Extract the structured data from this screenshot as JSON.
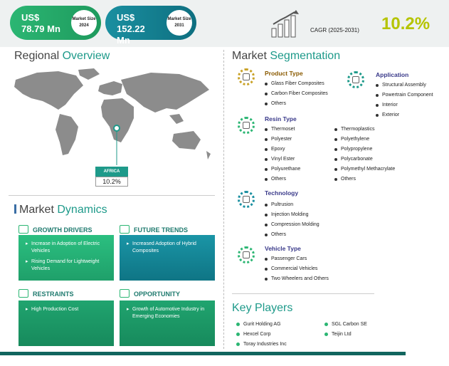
{
  "header": {
    "market_2024": {
      "value": "US$  78.79 Mn",
      "badge": "Market Size 2024"
    },
    "market_2031": {
      "value": "US$  152.22 Mn",
      "badge": "Market Size 2031"
    },
    "cagr_label": "CAGR (2025-2031)",
    "cagr_value": "10.2%",
    "colors": {
      "green": "#2bb673",
      "teal": "#0e6f80",
      "accent": "#b5c400"
    }
  },
  "regional": {
    "title_a": "Regional",
    "title_b": "Overview",
    "region_label": "AFRICA",
    "region_value": "10.2%"
  },
  "dynamics": {
    "title_a": "Market",
    "title_b": "Dynamics",
    "growth_drivers": {
      "label": "GROWTH DRIVERS",
      "items": [
        "Increase in Adoption of Electric Vehicles",
        "Rising Demand for Lightweight Vehicles"
      ]
    },
    "future_trends": {
      "label": "FUTURE TRENDS",
      "items": [
        "Increased Adoption of Hybrid Composites"
      ]
    },
    "restraints": {
      "label": "RESTRAINTS",
      "items": [
        "High Production Cost"
      ]
    },
    "opportunity": {
      "label": "OPPORTUNITY",
      "items": [
        "Growth of Automotive Industry in Emerging Economies"
      ]
    }
  },
  "segmentation": {
    "title_a": "Market",
    "title_b": "Segmentation",
    "product_type": {
      "label": "Product Type",
      "items": [
        "Glass Fiber Composites",
        "Carbon Fiber Composites",
        "Others"
      ]
    },
    "application": {
      "label": "Application",
      "items": [
        "Structural Assembly",
        "Powertrain Component",
        "Interior",
        "Exterior"
      ]
    },
    "resin_type": {
      "label": "Resin Type",
      "col1": [
        "Thermoset",
        "Polyester",
        "Epoxy",
        "Vinyl Ester",
        "Polyurethane",
        "Others"
      ],
      "col2": [
        "Thermoplastics",
        "Polyethylene",
        "Polypropylene",
        "Polycarbonate",
        "Polymethyl Methacrylate",
        "Others"
      ]
    },
    "technology": {
      "label": "Technology",
      "items": [
        "Pultrusion",
        "Injection Molding",
        "Compression Molding",
        "Others"
      ]
    },
    "vehicle_type": {
      "label": "Vehicle Type",
      "items": [
        "Passenger Cars",
        "Commercial Vehicles",
        "Two Wheelers and Others"
      ]
    }
  },
  "key_players": {
    "title": "Key Players",
    "col1": [
      "Gurit Holding AG",
      "Hexcel Corp",
      "Toray Industries Inc"
    ],
    "col2": [
      "SGL Carbon SE",
      "Teijin Ltd"
    ]
  }
}
